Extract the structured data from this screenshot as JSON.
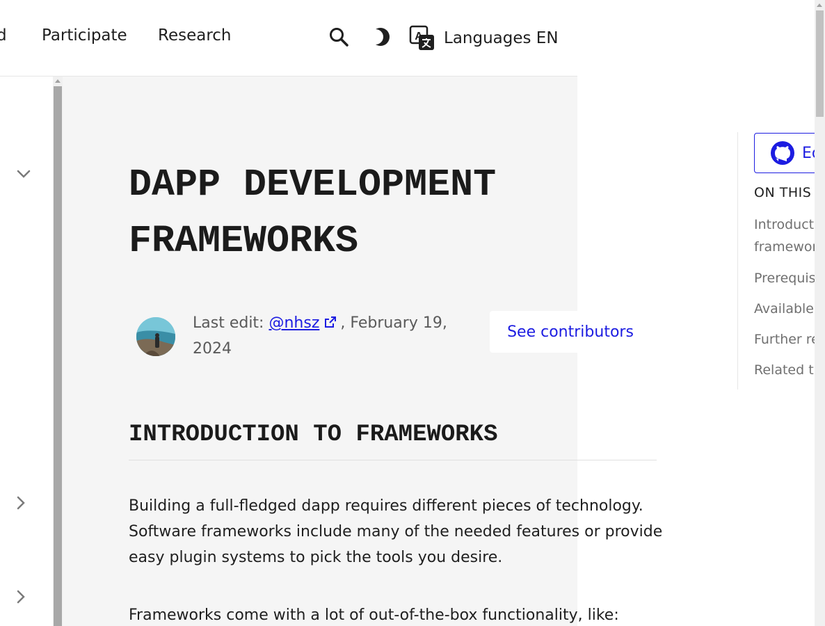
{
  "nav": {
    "cutoff_label": "d",
    "participate": "Participate",
    "research": "Research",
    "search_icon": "search-icon",
    "theme_icon": "moon-icon",
    "language_icon": "translate-icon",
    "languages_label": "Languages EN"
  },
  "sidebar": {
    "icons": [
      "chevron-down-icon",
      "chevron-right-icon",
      "chevron-right-icon"
    ]
  },
  "article": {
    "title": "DAPP DEVELOPMENT FRAMEWORKS",
    "last_edit_prefix": "Last edit: ",
    "author_handle": "@nhsz",
    "date_suffix": ", February 19, 2024",
    "see_contributors": "See contributors",
    "section_heading": "INTRODUCTION TO FRAMEWORKS",
    "paragraph_1": "Building a full-fledged dapp requires different pieces of technology. Software frameworks include many of the needed features or provide easy plugin systems to pick the tools you desire.",
    "paragraph_2": "Frameworks come with a lot of out-of-the-box functionality, like:"
  },
  "right_panel": {
    "edit_label": "Ed",
    "toc_title": "ON THIS",
    "toc_items": [
      "Introduct framewor",
      "Prerequis",
      "Available",
      "Further re",
      "Related t"
    ]
  },
  "colors": {
    "link": "#1c1ce1",
    "content_bg": "#f5f5f5",
    "text": "#1f1f1f",
    "muted": "#707070"
  }
}
